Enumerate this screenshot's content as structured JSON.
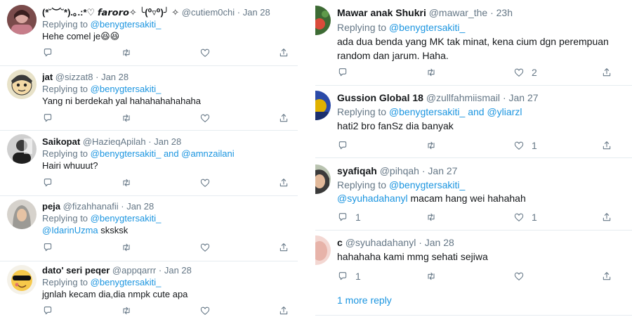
{
  "left": {
    "tweets": [
      {
        "name": "(*˘︶˘*).｡.:*♡ 𝙛𝙖𝙧𝙤𝙧𝙤✧ ╰(⁰▿⁰)╯ ✧",
        "handle": "@cutiem0chi",
        "sep": "·",
        "time": "Jan 28",
        "replying_prefix": "Replying to",
        "replying_to": "@benygtersakiti_",
        "replying_extra": "",
        "body": "Hehe comel je😆😆"
      },
      {
        "name": "jat",
        "handle": "@sizzat8",
        "sep": "·",
        "time": "Jan 28",
        "replying_prefix": "Replying to",
        "replying_to": "@benygtersakiti_",
        "replying_extra": "",
        "body": "Yang ni berdekah yal hahahahahahaha"
      },
      {
        "name": "Saikopat",
        "handle": "@HazieqApilah",
        "sep": "·",
        "time": "Jan 28",
        "replying_prefix": "Replying to",
        "replying_to": "@benygtersakiti_",
        "replying_and": "and",
        "replying_extra": "@amnzailani",
        "body": "Hairi whuuut?"
      },
      {
        "name": "peja",
        "handle": "@fizahhanafii",
        "sep": "·",
        "time": "Jan 28",
        "replying_prefix": "Replying to",
        "replying_to": "@benygtersakiti_",
        "replying_extra": "",
        "body_mention": "@IdarinUzma",
        "body": "sksksk"
      },
      {
        "name": "dato' seri peqer",
        "handle": "@appqarrr",
        "sep": "·",
        "time": "Jan 28",
        "replying_prefix": "Replying to",
        "replying_to": "@benygtersakiti_",
        "replying_extra": "",
        "body": "jgnlah kecam dia,dia nmpk cute apa"
      }
    ]
  },
  "right": {
    "tweets": [
      {
        "name": "Mawar anak Shukri",
        "handle": "@mawar_the",
        "sep": "·",
        "time": "23h",
        "replying_prefix": "Replying to",
        "replying_to": "@benygtersakiti_",
        "body_line1": "ada dua benda yang MK tak minat, kena cium dgn perempuan",
        "body_line2": "random dan jarum. Haha.",
        "reply_count": "",
        "like_count": "2"
      },
      {
        "name": "Gussion Global 18",
        "handle": "@zullfahmiismail",
        "sep": "·",
        "time": "Jan 27",
        "replying_prefix": "Replying to",
        "replying_to": "@benygtersakiti_",
        "replying_and": "and",
        "replying_extra": "@yliarzl",
        "body_line1": "hati2 bro fanSz dia banyak",
        "reply_count": "",
        "like_count": "1"
      },
      {
        "name": "syafiqah",
        "handle": "@pihqah",
        "sep": "·",
        "time": "Jan 27",
        "replying_prefix": "Replying to",
        "replying_to": "@benygtersakiti_",
        "body_mention": "@syuhadahanyl",
        "body_line1": "macam hang wei hahahah",
        "reply_count": "1",
        "like_count": "1"
      },
      {
        "name": "c",
        "handle": "@syuhadahanyl",
        "sep": "·",
        "time": "Jan 28",
        "body_line1": "hahahaha kami mmg sehati sejiwa",
        "reply_count": "1",
        "like_count": ""
      }
    ],
    "more_reply": "1 more reply"
  },
  "icons": [
    "reply-icon",
    "retweet-icon",
    "like-icon",
    "share-icon"
  ],
  "colors": {
    "accent": "#1b95e0",
    "muted": "#657786",
    "text": "#14171a",
    "divider": "#e6ecf0"
  }
}
